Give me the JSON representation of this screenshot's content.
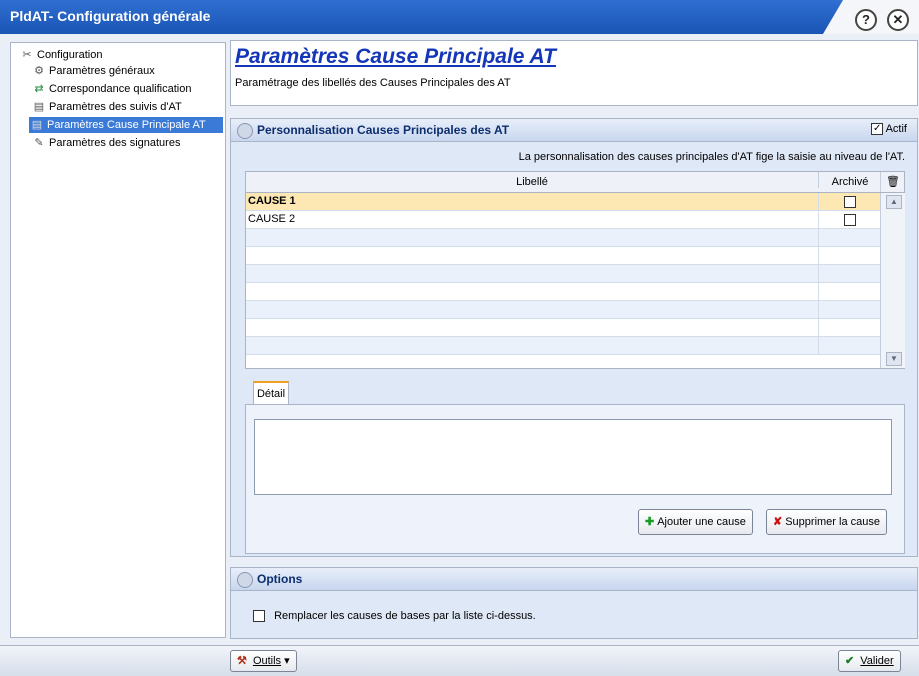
{
  "window": {
    "title": "PldAT- Configuration générale",
    "help_glyph": "?",
    "close_glyph": "✕"
  },
  "sidebar": {
    "root_label": "Configuration",
    "items": [
      {
        "label": "Paramètres généraux",
        "icon": "gear-icon"
      },
      {
        "label": "Correspondance qualification",
        "icon": "arrows-icon"
      },
      {
        "label": "Paramètres des suivis d'AT",
        "icon": "page-icon"
      },
      {
        "label": "Paramètres Cause Principale AT",
        "icon": "page-icon"
      },
      {
        "label": "Paramètres des signatures",
        "icon": "pen-icon"
      }
    ]
  },
  "header": {
    "title": "Paramètres Cause Principale AT",
    "subtitle": "Paramétrage des libellés des Causes Principales des AT"
  },
  "causes_section": {
    "title": "Personnalisation Causes Principales des AT",
    "actif_label": "Actif",
    "actif_checked": "✓",
    "info": "La personnalisation des causes principales d'AT fige la saisie au niveau de l'AT.",
    "columns": {
      "libelle": "Libellé",
      "archive": "Archivé"
    },
    "rows": [
      {
        "libelle": "CAUSE 1",
        "archive": ""
      },
      {
        "libelle": "CAUSE 2",
        "archive": ""
      }
    ],
    "detail_tab": "Détail",
    "add_button": "Ajouter une cause",
    "delete_button": "Supprimer la cause"
  },
  "options_section": {
    "title": "Options",
    "replace_label": "Remplacer les causes de bases par la liste ci-dessus."
  },
  "bottom": {
    "tools_label": "Outils",
    "validate_label": "Valider"
  }
}
